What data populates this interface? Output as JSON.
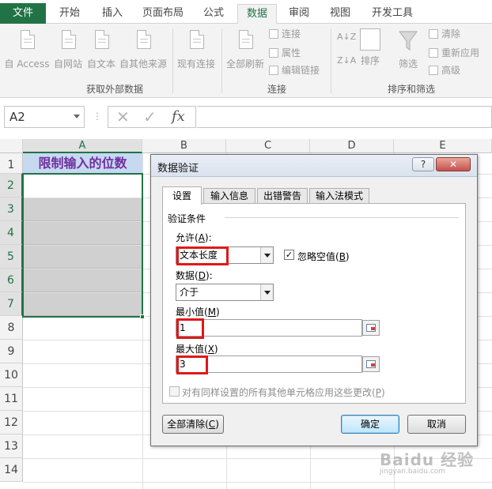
{
  "tabs": [
    "文件",
    "开始",
    "插入",
    "页面布局",
    "公式",
    "数据",
    "审阅",
    "视图",
    "开发工具"
  ],
  "active_tab": "数据",
  "ribbon": {
    "get_external": {
      "buttons": [
        "自 Access",
        "自网站",
        "自文本",
        "自其他来源"
      ],
      "existing": "现有连接",
      "label": "获取外部数据"
    },
    "connections": {
      "refresh_all": "全部刷新",
      "items": [
        "连接",
        "属性",
        "编辑链接"
      ],
      "label": "连接"
    },
    "sort_filter": {
      "sort": "排序",
      "filter": "筛选",
      "items": [
        "清除",
        "重新应用",
        "高级"
      ],
      "label": "排序和筛选"
    }
  },
  "formula_bar": {
    "name_box": "A2",
    "cancel_icon": "✕",
    "enter_icon": "✓",
    "fx": "fx",
    "value": ""
  },
  "sheet": {
    "columns": [
      "A",
      "B",
      "C",
      "D",
      "E"
    ],
    "rows": [
      "1",
      "2",
      "3",
      "4",
      "5",
      "6",
      "7",
      "8",
      "9",
      "10",
      "11",
      "12",
      "13",
      "14"
    ],
    "a1": "限制输入的位数",
    "selected_col": "A",
    "active_cell": "A2"
  },
  "dialog": {
    "title": "数据验证",
    "help": "?",
    "close": "✕",
    "tabs": [
      "设置",
      "输入信息",
      "出错警告",
      "输入法模式"
    ],
    "section": "验证条件",
    "allow_label": "允许(",
    "allow_key": "A",
    "allow_tail": "):",
    "allow_value": "文本长度",
    "ignore_blank_pre": "忽略空值(",
    "ignore_blank_key": "B",
    "ignore_blank_post": ")",
    "ignore_blank_checked": "✓",
    "data_label": "数据(",
    "data_key": "D",
    "data_tail": "):",
    "data_value": "介于",
    "min_label": "最小值(",
    "min_key": "M",
    "min_tail": ")",
    "min_value": "1",
    "max_label": "最大值(",
    "max_key": "X",
    "max_tail": ")",
    "max_value": "3",
    "apply_all_pre": "对有同样设置的所有其他单元格应用这些更改(",
    "apply_all_key": "P",
    "apply_all_post": ")",
    "clear_all_pre": "全部清除(",
    "clear_all_key": "C",
    "clear_all_post": ")",
    "ok": "确定",
    "cancel": "取消"
  },
  "watermark": {
    "brand": "Baidu 经验",
    "url": "jingyan.baidu.com"
  }
}
